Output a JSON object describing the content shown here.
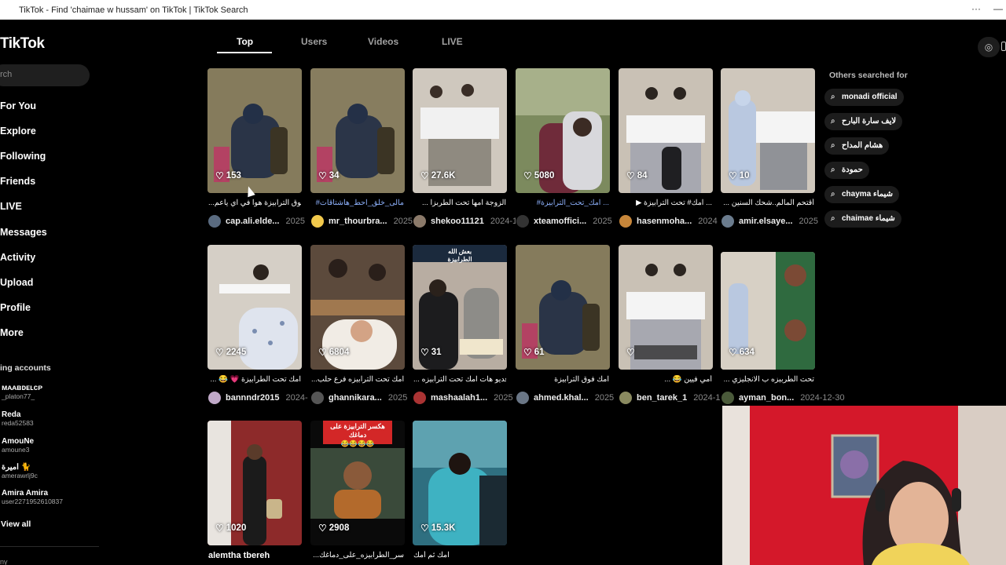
{
  "window": {
    "title": "TikTok - Find 'chaimae w hussam' on TikTok | TikTok Search",
    "menu_glyph": "···",
    "min_glyph": "—"
  },
  "sidebar": {
    "logo": "TikTok",
    "search_placeholder": "rch",
    "nav": [
      "For You",
      "Explore",
      "Following",
      "Friends",
      "LIVE",
      "Messages",
      "Activity",
      "Upload",
      "Profile",
      "More"
    ],
    "accounts_label": "ing accounts",
    "accounts": [
      {
        "name": "ᴍᴀᴀʙᴅᴇʟᴄᴘ",
        "user": "_platon77_"
      },
      {
        "name": "Reda",
        "user": "reda52583"
      },
      {
        "name": "AmouNe",
        "user": "amoune3"
      },
      {
        "name": "اميرة 🐈",
        "user": "amerawrlj9c"
      },
      {
        "name": "Amira Amira",
        "user": "user2271952610837"
      }
    ],
    "view_all": "View all",
    "more_label": "ny"
  },
  "tabs": [
    "Top",
    "Users",
    "Videos",
    "LIVE"
  ],
  "others": {
    "title": "Others searched for",
    "chips": [
      "monadi official",
      "لايف سارة البارح",
      "هشام المداح",
      "حمودة",
      "chayma شيماء",
      "chaimae شيماء"
    ]
  },
  "videos": [
    {
      "likes": "153",
      "caption": "...سوق الترابيزة هوا في اي ياعم",
      "author": "cap.ali.elde...",
      "date": "2025",
      "tag": false
    },
    {
      "likes": "34",
      "caption": "#مالى_خلق_احط_هاشتاقات",
      "author": "mr_thourbra...",
      "date": "2025",
      "tag": true
    },
    {
      "likes": "27.6K",
      "caption": "... الزوجة امها تحت الطربزا",
      "author": "shekoo11121",
      "date": "2024-1",
      "tag": false
    },
    {
      "likes": "5080",
      "caption": "#امك_تحت_الترابيزة ...",
      "author": "xteamoffici...",
      "date": "2025",
      "tag": true
    },
    {
      "likes": "84",
      "caption": "▶ امك# تحت الترابيزة ...",
      "author": "hasenmoha...",
      "date": "2024",
      "tag": false
    },
    {
      "likes": "10",
      "caption": "... أقتحم المالم..شحك السنين",
      "author": "amir.elsaye...",
      "date": "2025",
      "tag": false
    },
    {
      "likes": "2245",
      "caption": "... 😂 💗 امك تحت الطرابيزة",
      "author": "bannndr2015",
      "date": "2024-",
      "tag": false
    },
    {
      "likes": "6804",
      "caption": "...امك تحت الترابيزه فرع حلب",
      "author": "ghannikara...",
      "date": "2025",
      "tag": false
    },
    {
      "likes": "31",
      "caption": "... فديو هات امك تحت الترابيزه",
      "author": "mashaalah1...",
      "date": "2025",
      "tag": false
    },
    {
      "likes": "61",
      "caption": "امك فوق الترابيزة",
      "author": "ahmed.khal...",
      "date": "2025",
      "tag": false
    },
    {
      "likes": "",
      "caption": "... 😂 أمي فيين",
      "author": "ben_tarek_1",
      "date": "2024-1",
      "tag": false
    },
    {
      "likes": "634",
      "caption": "... تحت الطربيزه ب الانجليزي",
      "author": "ayman_bon...",
      "date": "2024-12-30",
      "tag": false
    },
    {
      "likes": "1020",
      "caption": "alemtha tbereh",
      "author": "",
      "date": "",
      "tag": false
    },
    {
      "likes": "2908",
      "caption": "...سر_الطرابيزه_على_دماغك",
      "author": "",
      "date": "",
      "tag": false
    },
    {
      "likes": "15.3K",
      "caption": "امك ثم أمك",
      "author": "",
      "date": "",
      "tag": false
    }
  ],
  "overlays": [
    "هكسر الترابيزة على دماغك",
    "😂😂😂😂",
    "بعش الله",
    "الطرابيزة"
  ]
}
